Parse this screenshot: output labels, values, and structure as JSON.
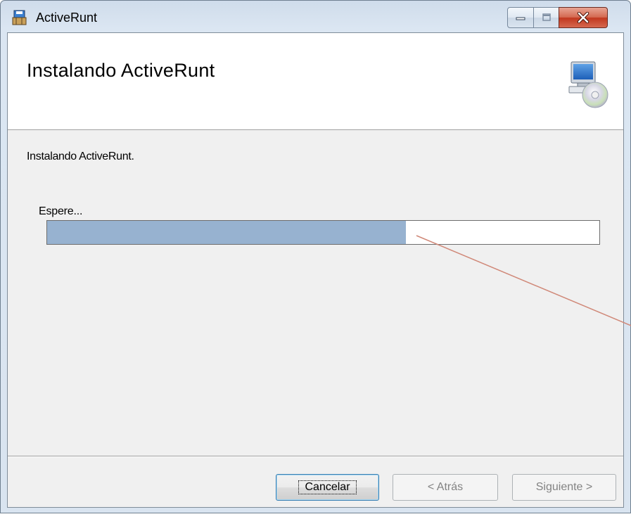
{
  "window": {
    "title": "ActiveRunt"
  },
  "header": {
    "title": "Instalando ActiveRunt",
    "icon": "computer-cd-icon"
  },
  "main": {
    "status_text": "Instalando ActiveRunt.",
    "progress_label": "Espere...",
    "progress_fraction": 0.65
  },
  "buttons": {
    "cancel": "Cancelar",
    "back": "< Atrás",
    "next": "Siguiente >"
  },
  "colors": {
    "progress_fill": "#97b2d0",
    "annotation_line": "#d08878"
  }
}
